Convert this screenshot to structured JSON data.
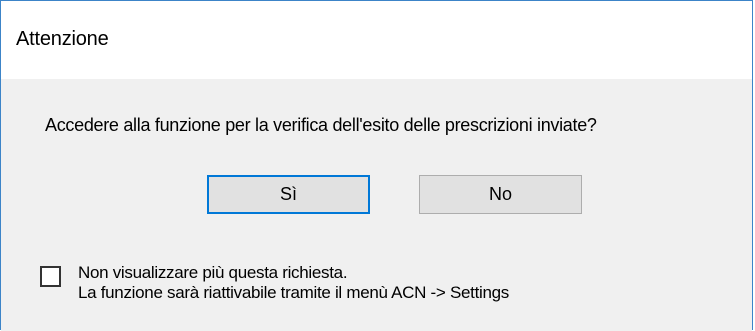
{
  "dialog": {
    "title": "Attenzione",
    "message": "Accedere alla funzione per la verifica dell'esito delle prescrizioni inviate?",
    "buttons": {
      "yes_label": "Sì",
      "no_label": "No"
    },
    "checkbox": {
      "checked": false,
      "label_line1": "Non visualizzare più questa richiesta.",
      "label_line2": "La funzione sarà riattivabile tramite il menù ACN -> Settings"
    }
  },
  "colors": {
    "window_border": "#3c84c8",
    "title_bg": "#ffffff",
    "content_bg": "#f0f0f0",
    "default_button_border": "#0078d7",
    "button_bg": "#e1e1e1"
  }
}
